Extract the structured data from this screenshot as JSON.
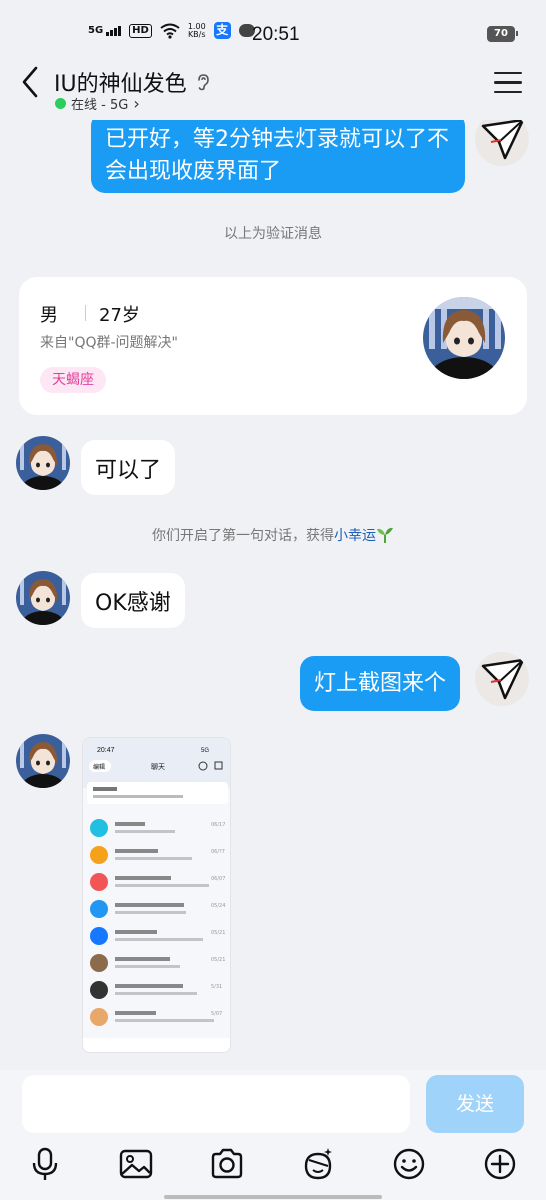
{
  "status": {
    "network": "5G",
    "hd": "HD",
    "speed_value": "1.00",
    "speed_unit": "KB/s",
    "app_icon": "支",
    "time": "20:51",
    "battery": "70"
  },
  "header": {
    "title": "IU的神仙发色",
    "presence": "在线 - 5G",
    "presence_chevron": "›"
  },
  "messages": {
    "m1": "已开好，等2分钟去灯录就可以了不会出现收废界面了",
    "sys_verify": "以上为验证消息",
    "m2": "可以了",
    "sys_first_prefix": "你们开启了第一句对话，获得",
    "sys_first_link": "小幸运",
    "m3": "OK感谢",
    "m4": "灯上截图来个"
  },
  "profile_card": {
    "gender": "男",
    "age": "27岁",
    "from": "来自\"QQ群-问题解决\"",
    "zodiac": "天蝎座"
  },
  "screenshot_preview": {
    "time": "20:47",
    "network": "5G",
    "edit": "编辑",
    "tab": "聊天",
    "dates": [
      "06/17",
      "06/?7",
      "06/07",
      "05/24",
      "05/21",
      "05/21",
      "5/31",
      "5/07"
    ],
    "row_colors": [
      "#21c0e0",
      "#f4a21c",
      "#f25555",
      "#2196f3",
      "#1677ff",
      "#8c6a4c",
      "#333333",
      "#e8a86a"
    ]
  },
  "composer": {
    "send_label": "发送"
  },
  "colors": {
    "outgoing_bubble": "#1a9cf5",
    "online_dot": "#2ccd5c",
    "send_button": "#9fd3fa"
  }
}
